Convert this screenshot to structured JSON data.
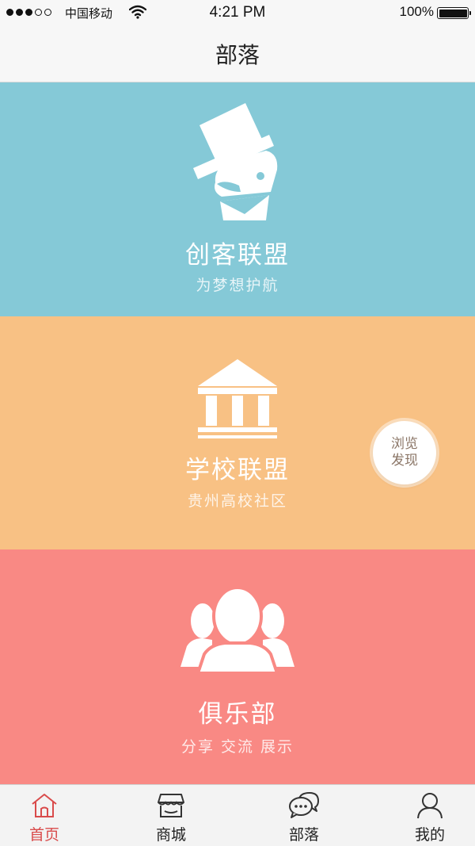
{
  "status_bar": {
    "carrier": "中国移动",
    "time": "4:21 PM",
    "battery": "100%"
  },
  "nav": {
    "title": "部落"
  },
  "panels": [
    {
      "title": "创客联盟",
      "subtitle": "为梦想护航",
      "icon": "top-hat-mascot-icon",
      "color": "#85c9d7"
    },
    {
      "title": "学校联盟",
      "subtitle": "贵州高校社区",
      "icon": "institution-building-icon",
      "color": "#f8c184"
    },
    {
      "title": "俱乐部",
      "subtitle": "分享 交流 展示",
      "icon": "group-people-icon",
      "color": "#f98984"
    }
  ],
  "bubble": {
    "line1": "浏览",
    "line2": "发现"
  },
  "tabs": [
    {
      "label": "首页",
      "icon": "home-icon",
      "active": true
    },
    {
      "label": "商城",
      "icon": "store-icon",
      "active": false
    },
    {
      "label": "部落",
      "icon": "chat-bubbles-icon",
      "active": false
    },
    {
      "label": "我的",
      "icon": "user-icon",
      "active": false
    }
  ],
  "colors": {
    "accent": "#d94b4b",
    "bubble_text": "#8a7566"
  }
}
